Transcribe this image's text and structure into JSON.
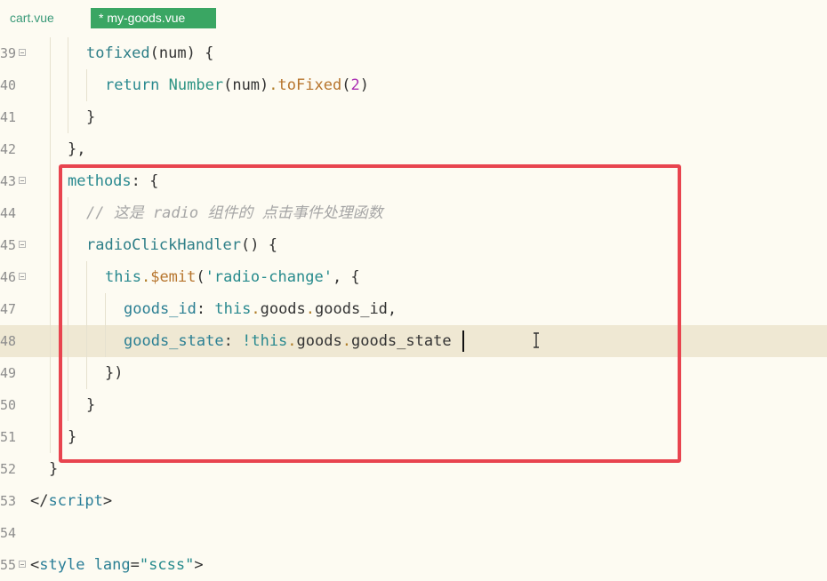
{
  "tabs": [
    {
      "label": "cart.vue",
      "active": false
    },
    {
      "label": "* my-goods.vue",
      "active": true
    }
  ],
  "colors": {
    "tab_active_bg": "#3aa663",
    "annotation_box": "#e8444f",
    "current_line": "#efe8d3",
    "editor_bg": "#fdfbf2"
  },
  "icons": {
    "fold": "fold-toggle-icon",
    "cursor": "text-ibeam-cursor-icon"
  },
  "editor": {
    "current_line_number": "48",
    "lines": [
      {
        "n": "39",
        "t": [
          "tofixed",
          "(num) {"
        ]
      },
      {
        "n": "40",
        "t": [
          "return",
          "Number",
          "(num)",
          ".",
          "toFixed",
          "(",
          "2",
          ")"
        ]
      },
      {
        "n": "41",
        "t": [
          "}"
        ]
      },
      {
        "n": "42",
        "t": [
          "},"
        ]
      },
      {
        "n": "43",
        "t": [
          "methods",
          ": {"
        ]
      },
      {
        "n": "44",
        "t": [
          "// 这是 radio 组件的 点击事件处理函数"
        ]
      },
      {
        "n": "45",
        "t": [
          "radioClickHandler",
          "() {"
        ]
      },
      {
        "n": "46",
        "t": [
          "this",
          ".",
          "$emit",
          "(",
          "'radio-change'",
          ", {"
        ]
      },
      {
        "n": "47",
        "t": [
          "goods_id",
          ":",
          "this",
          ".",
          "goods",
          ".",
          "goods_id",
          ","
        ]
      },
      {
        "n": "48",
        "t": [
          "goods_state",
          ":",
          "!",
          "this",
          ".",
          "goods",
          ".",
          "goods_state"
        ]
      },
      {
        "n": "49",
        "t": [
          "})"
        ]
      },
      {
        "n": "50",
        "t": [
          "}"
        ]
      },
      {
        "n": "51",
        "t": [
          "}"
        ]
      },
      {
        "n": "52",
        "t": [
          "}"
        ]
      },
      {
        "n": "53",
        "t": [
          "</",
          "script",
          ">"
        ]
      },
      {
        "n": "54",
        "t": []
      },
      {
        "n": "55",
        "t": [
          "<",
          "style",
          " ",
          "lang",
          "=",
          "\"scss\"",
          ">"
        ]
      }
    ]
  }
}
